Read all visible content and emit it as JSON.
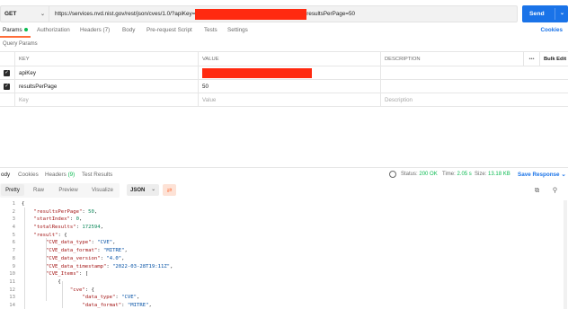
{
  "request": {
    "method": "GET",
    "url_prefix": "https://services.nvd.nist.gov/rest/json/cves/1.0/?apiKey=",
    "url_suffix": "resultsPerPage=50",
    "send_label": "Send"
  },
  "request_tabs": [
    {
      "label": "Params"
    },
    {
      "label": "Authorization"
    },
    {
      "label": "Headers (7)"
    },
    {
      "label": "Body"
    },
    {
      "label": "Pre-request Script"
    },
    {
      "label": "Tests"
    },
    {
      "label": "Settings"
    }
  ],
  "cookies_label": "Cookies",
  "query_params_label": "Query Params",
  "params_table": {
    "headers": {
      "key": "KEY",
      "value": "VALUE",
      "description": "DESCRIPTION",
      "more": "•••",
      "bulk_edit": "Bulk Edit"
    },
    "rows": [
      {
        "key": "apiKey",
        "value": ""
      },
      {
        "key": "resultsPerPage",
        "value": "50"
      }
    ],
    "placeholders": {
      "key": "Key",
      "value": "Value",
      "description": "Description"
    }
  },
  "response": {
    "tabs": [
      {
        "label": "ody"
      },
      {
        "label": "Cookies"
      },
      {
        "label": "Headers",
        "count": "(9)"
      },
      {
        "label": "Test Results"
      }
    ],
    "status_label": "Status:",
    "status_value": "200 OK",
    "time_label": "Time:",
    "time_value": "2.05 s",
    "size_label": "Size:",
    "size_value": "13.18 KB",
    "save_label": "Save Response",
    "views": [
      {
        "label": "Pretty"
      },
      {
        "label": "Raw"
      },
      {
        "label": "Preview"
      },
      {
        "label": "Visualize"
      }
    ],
    "format": "JSON"
  },
  "code_lines": [
    {
      "n": "1",
      "text": "{"
    },
    {
      "n": "2",
      "text": "    \"resultsPerPage\": 50,"
    },
    {
      "n": "3",
      "text": "    \"startIndex\": 0,"
    },
    {
      "n": "4",
      "text": "    \"totalResults\": 172594,"
    },
    {
      "n": "5",
      "text": "    \"result\": {"
    },
    {
      "n": "6",
      "text": "        \"CVE_data_type\": \"CVE\","
    },
    {
      "n": "7",
      "text": "        \"CVE_data_format\": \"MITRE\","
    },
    {
      "n": "8",
      "text": "        \"CVE_data_version\": \"4.0\","
    },
    {
      "n": "9",
      "text": "        \"CVE_data_timestamp\": \"2022-03-28T19:11Z\","
    },
    {
      "n": "10",
      "text": "        \"CVE_Items\": ["
    },
    {
      "n": "11",
      "text": "            {"
    },
    {
      "n": "12",
      "text": "                \"cve\": {"
    },
    {
      "n": "13",
      "text": "                    \"data_type\": \"CVE\","
    },
    {
      "n": "14",
      "text": "                    \"data_format\": \"MITRE\","
    }
  ],
  "colors": {
    "send": "#1a73e8",
    "accent": "#ff6c37",
    "status_ok": "#0cbb52",
    "redaction": "#ff2a10"
  },
  "icons": [
    "chevron-down-icon",
    "globe-icon",
    "wrap-lines-icon",
    "copy-icon",
    "search-icon",
    "more-icon"
  ]
}
